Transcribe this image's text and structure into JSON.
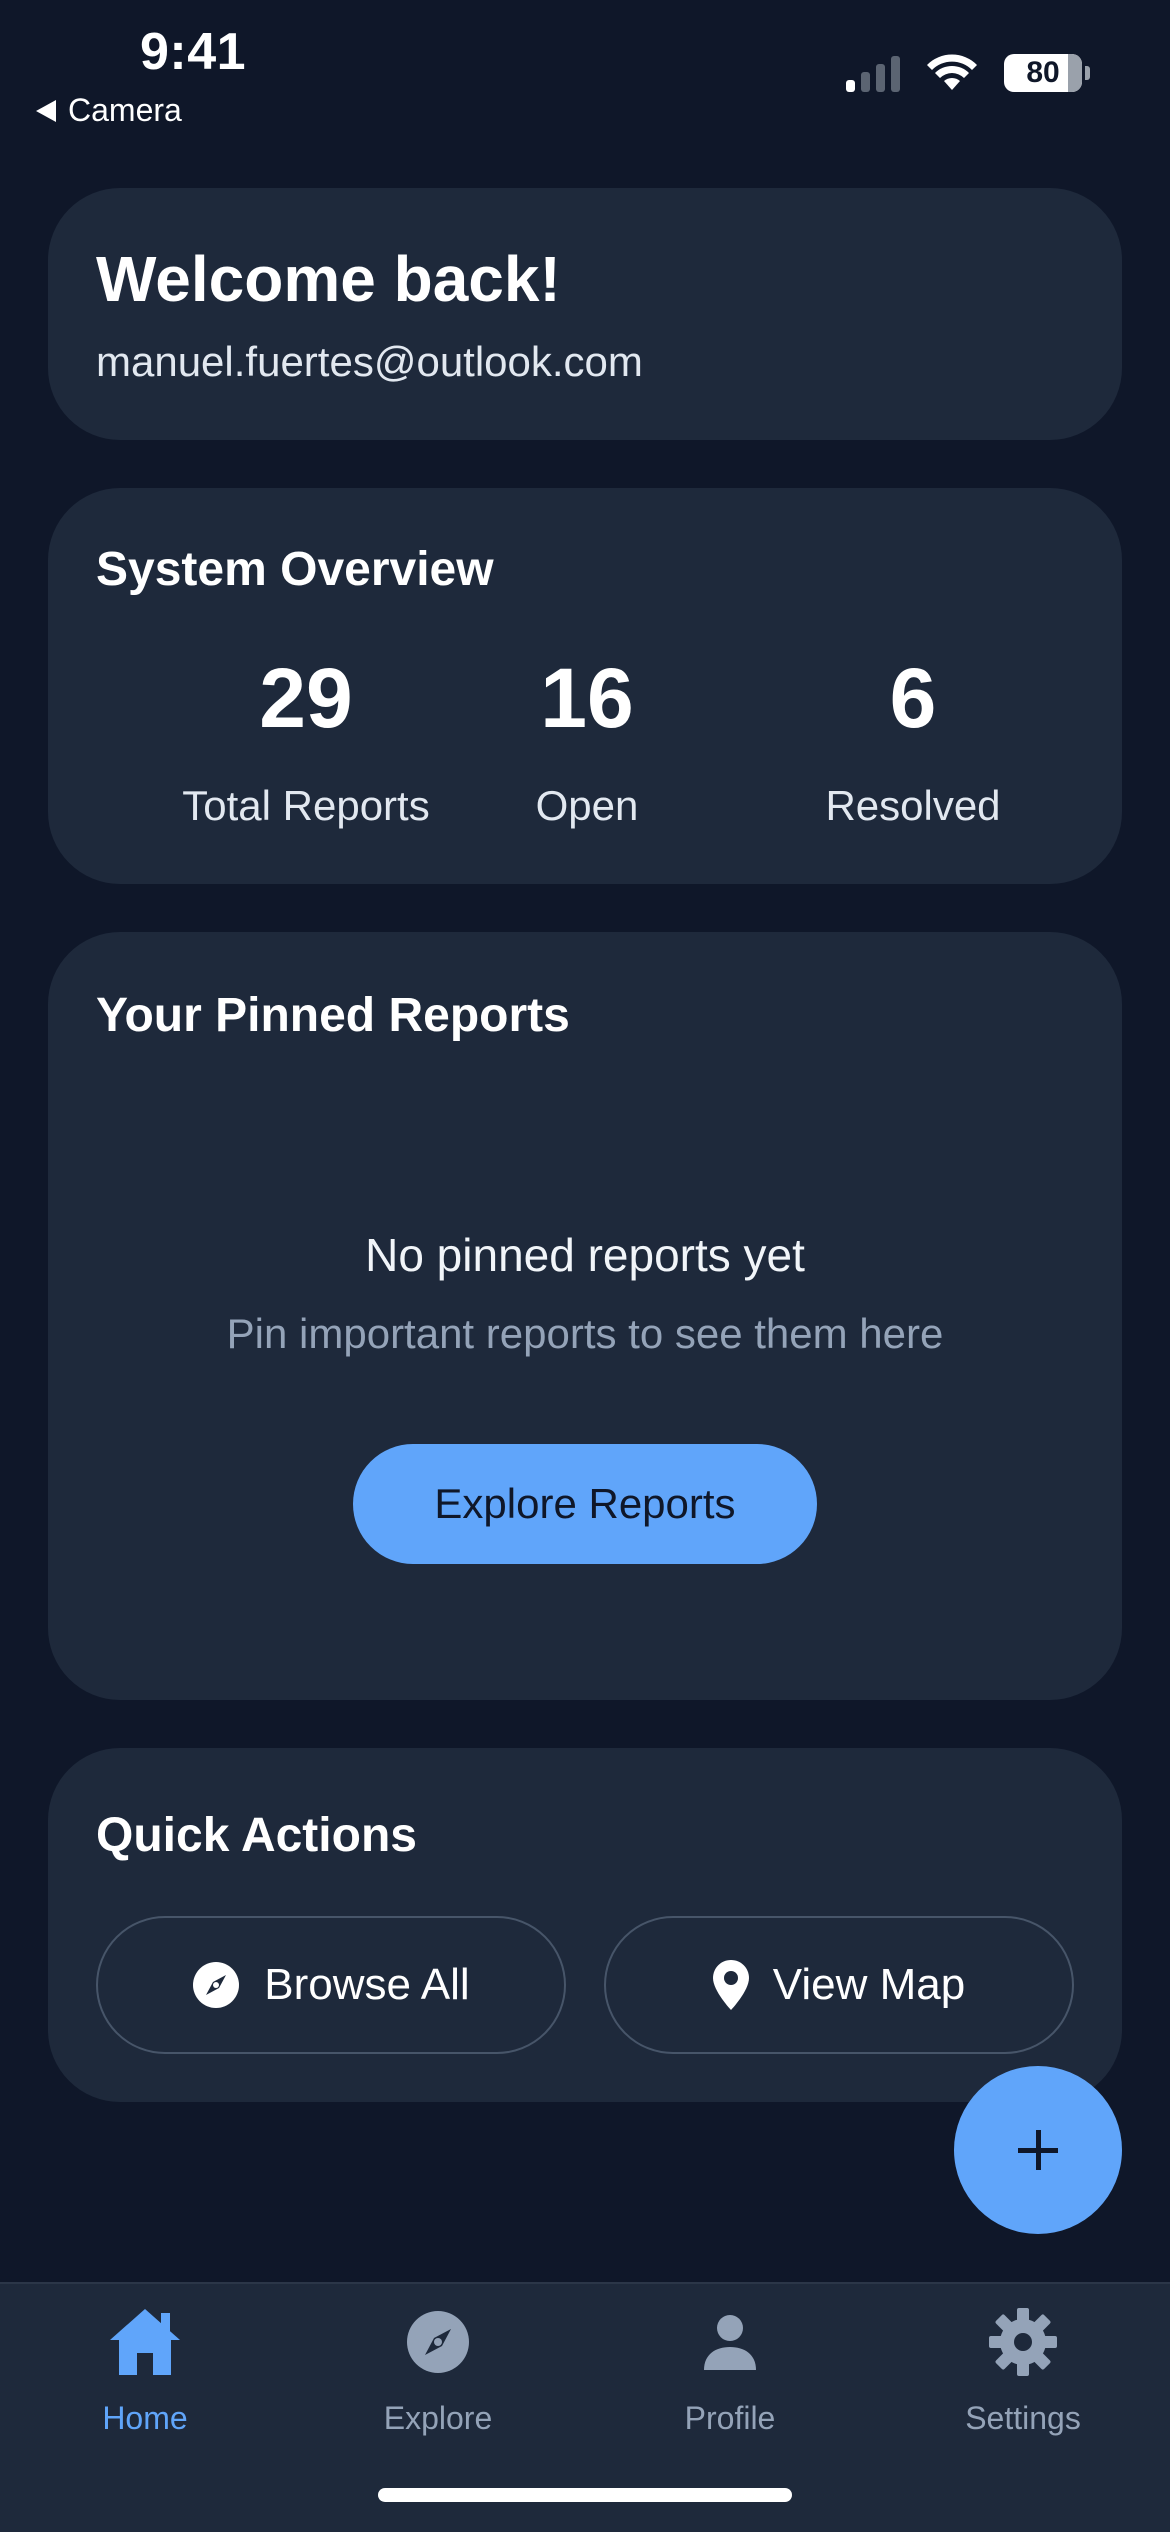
{
  "status_bar": {
    "time": "9:41",
    "back_app": "Camera",
    "battery": "80",
    "signal_bars_on": 1,
    "icons": [
      "cellular-signal-icon",
      "wifi-icon",
      "battery-icon"
    ]
  },
  "welcome": {
    "title": "Welcome back!",
    "email": "manuel.fuertes@outlook.com"
  },
  "overview": {
    "title": "System Overview",
    "stats": [
      {
        "value": "29",
        "label": "Total Reports"
      },
      {
        "value": "16",
        "label": "Open"
      },
      {
        "value": "6",
        "label": "Resolved"
      }
    ]
  },
  "pinned": {
    "title": "Your Pinned Reports",
    "empty_title": "No pinned reports yet",
    "empty_subtitle": "Pin important reports to see them here",
    "button_label": "Explore Reports"
  },
  "quick_actions": {
    "title": "Quick Actions",
    "browse_label": "Browse All",
    "map_label": "View Map"
  },
  "fab": {
    "icon": "plus-icon"
  },
  "tabs": [
    {
      "label": "Home",
      "icon": "home-icon",
      "active": true
    },
    {
      "label": "Explore",
      "icon": "compass-icon",
      "active": false
    },
    {
      "label": "Profile",
      "icon": "person-icon",
      "active": false
    },
    {
      "label": "Settings",
      "icon": "gear-icon",
      "active": false
    }
  ],
  "colors": {
    "background": "#0f1729",
    "card": "#1e293b",
    "accent": "#60a5fa",
    "muted_text": "#94a3b8"
  }
}
